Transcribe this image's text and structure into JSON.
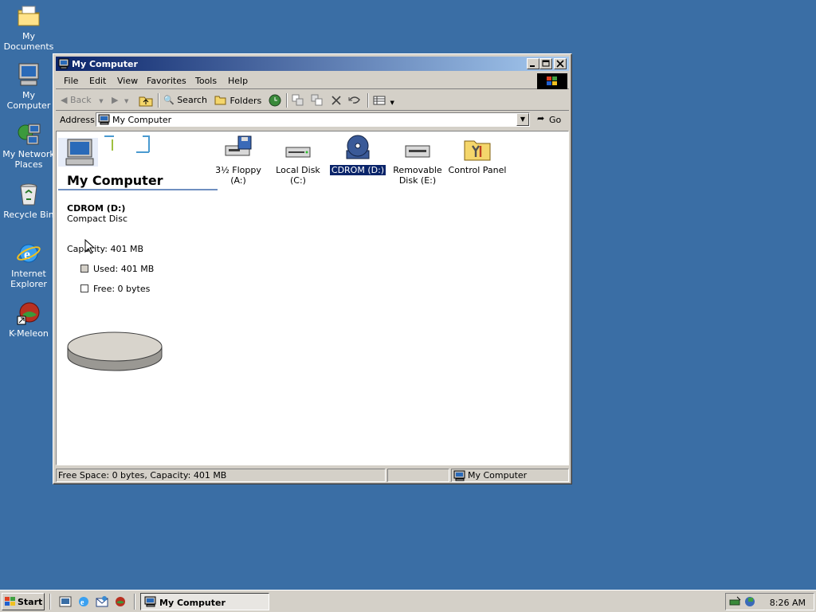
{
  "desktop": {
    "icons": [
      {
        "label": "My Documents",
        "icon": "folder-documents-icon"
      },
      {
        "label": "My Computer",
        "icon": "computer-icon"
      },
      {
        "label": "My Network Places",
        "icon": "network-places-icon"
      },
      {
        "label": "Recycle Bin",
        "icon": "recycle-bin-icon"
      },
      {
        "label": "Internet Explorer",
        "icon": "internet-explorer-icon"
      },
      {
        "label": "K-Meleon",
        "icon": "k-meleon-icon"
      }
    ]
  },
  "window": {
    "title": "My Computer",
    "menu": [
      "File",
      "Edit",
      "View",
      "Favorites",
      "Tools",
      "Help"
    ],
    "toolbar": {
      "back": "Back",
      "search": "Search",
      "folders": "Folders"
    },
    "address": {
      "label": "Address",
      "value": "My Computer",
      "go": "Go"
    },
    "left_panel": {
      "title": "My Computer",
      "selected_name": "CDROM (D:)",
      "selected_type": "Compact Disc",
      "capacity": "Capacity: 401 MB",
      "used": "Used: 401 MB",
      "free": "Free: 0 bytes"
    },
    "drives": [
      {
        "label": "3½ Floppy (A:)",
        "icon": "floppy-drive-icon",
        "selected": false
      },
      {
        "label": "Local Disk (C:)",
        "icon": "hard-disk-icon",
        "selected": false
      },
      {
        "label": "CDROM (D:)",
        "icon": "cdrom-icon",
        "selected": true
      },
      {
        "label": "Removable Disk (E:)",
        "icon": "removable-disk-icon",
        "selected": false
      },
      {
        "label": "Control Panel",
        "icon": "control-panel-icon",
        "selected": false
      }
    ],
    "status": {
      "main": "Free Space: 0 bytes, Capacity: 401 MB",
      "zone": "My Computer"
    }
  },
  "taskbar": {
    "start": "Start",
    "task": "My Computer",
    "clock": "8:26 AM"
  },
  "colors": {
    "desktop": "#3a6ea5",
    "title_active": "#0a246a",
    "selection": "#0a246a"
  }
}
